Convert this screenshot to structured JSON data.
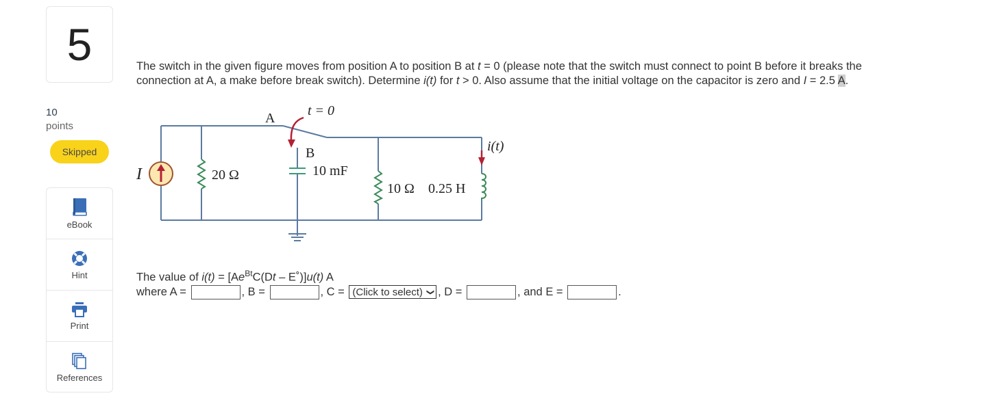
{
  "question": {
    "number": "5",
    "points_value": "10",
    "points_label": "points",
    "status_badge": "Skipped"
  },
  "tools": [
    {
      "label": "eBook",
      "icon": "book-icon"
    },
    {
      "label": "Hint",
      "icon": "lifebuoy-icon"
    },
    {
      "label": "Print",
      "icon": "printer-icon"
    },
    {
      "label": "References",
      "icon": "documents-icon"
    }
  ],
  "prompt": {
    "part1": "The switch in the given figure moves from position A to position B at ",
    "t": "t",
    "part2": " = 0 (please note that the switch must connect to point B before it breaks the connection at A, a make before break switch). Determine ",
    "it": "i(t)",
    "part3": " for ",
    "t2": "t",
    "part4": " > 0. Also assume that the initial voltage on the capacitor is zero and ",
    "I": "I",
    "part5": " = 2.5 ",
    "unit_highlight": "A",
    "part6": "."
  },
  "circuit": {
    "switch_label": "t = 0",
    "node_a": "A",
    "node_b": "B",
    "source_label": "I",
    "r1": "20 Ω",
    "capacitor": "10 mF",
    "r2": "10 Ω",
    "inductor": "0.25 H",
    "current_label": "i(t)"
  },
  "answer": {
    "line1_pre": "The value of ",
    "line1_it": "i(t)",
    "line1_mid": " = [A",
    "line1_e": "e",
    "line1_sup": "Bt",
    "line1_post": "C(D",
    "line1_t": "t",
    "line1_end": " – E˚)]",
    "line1_u": "u(t)",
    "line1_unit": " A",
    "where": "where A = ",
    "b_label": ", B = ",
    "c_label": ", C = ",
    "c_select": "(Click to select)",
    "d_label": ", D = ",
    "e_label": ", and E = ",
    "period": ".",
    "fields": {
      "A": "",
      "B": "",
      "D": "",
      "E": ""
    }
  }
}
